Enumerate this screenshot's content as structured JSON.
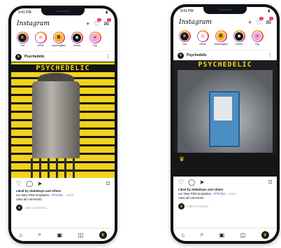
{
  "phone1": {
    "status_time": "9:41 PM",
    "logo": "Instagram",
    "header_icons": {
      "add": "+",
      "heart": "♡",
      "heart_badge": "2",
      "message": "✉",
      "message_badge": "1"
    },
    "stories": [
      {
        "label": "You",
        "glyph": "♛"
      },
      {
        "label": "AIFile",
        "glyph": "◎"
      },
      {
        "label": "InspiringBee",
        "glyph": "B"
      },
      {
        "label": "Ozone",
        "glyph": "◉"
      },
      {
        "label": "Figi",
        "glyph": "●"
      }
    ],
    "post_user": "Psychedelic",
    "post_title": "PSYCHEDELIC",
    "liked_by": "Liked by AbduDayn and others",
    "caption": "our New PSD templates..",
    "hashtag": "#PsFiles",
    "more": "...more",
    "view_comments": "View all comments",
    "add_comment": "Add a comment..."
  },
  "phone2": {
    "status_time": "9:41 PM",
    "logo": "Instagram",
    "header_icons": {
      "add": "+",
      "heart": "♡",
      "heart_badge": "2",
      "message": "✉",
      "message_badge": "1"
    },
    "stories": [
      {
        "label": "You",
        "glyph": "♛"
      },
      {
        "label": "AIFile",
        "glyph": "◎"
      },
      {
        "label": "InspiringBee",
        "glyph": "B"
      },
      {
        "label": "Ozone",
        "glyph": "◉"
      },
      {
        "label": "Figi",
        "glyph": "●"
      }
    ],
    "post_user": "Psychedelic",
    "post_title": "PSYCHEDELIC",
    "liked_by": "Liked by AbduDayn and others",
    "caption": "our New PSD templates..",
    "hashtag": "#PsFiles",
    "more": "...more",
    "view_comments": "View all comments",
    "add_comment": "Add a comment..."
  },
  "icons": {
    "more": "⋮",
    "like": "♡",
    "comment": "◯",
    "share": "➤",
    "save": "⌑",
    "home": "⌂",
    "search": "⌕",
    "reels": "▣",
    "shop": "◫",
    "profile": "♛"
  }
}
